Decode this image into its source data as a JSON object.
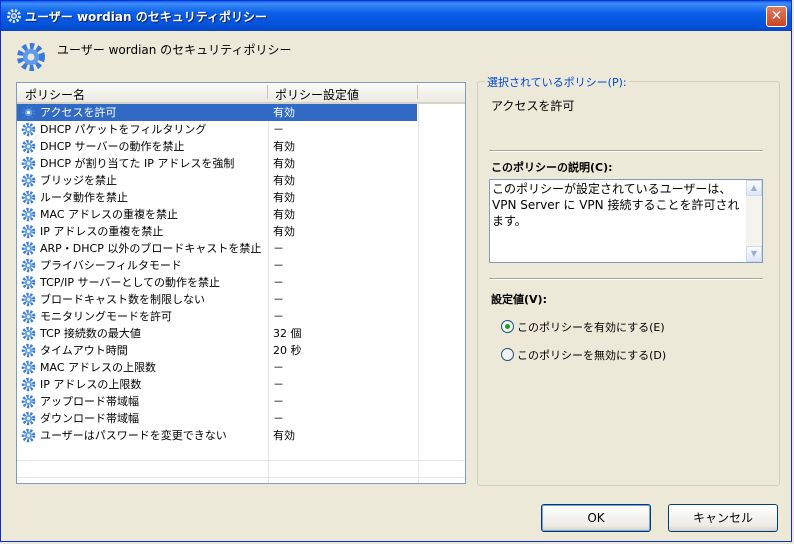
{
  "window": {
    "title": "ユーザー wordian のセキュリティポリシー",
    "close_label": "✕"
  },
  "header": {
    "text": "ユーザー wordian のセキュリティポリシー"
  },
  "list": {
    "columns": [
      "ポリシー名",
      "ポリシー設定値"
    ],
    "rows": [
      {
        "name": "アクセスを許可",
        "value": "有効"
      },
      {
        "name": "DHCP パケットをフィルタリング",
        "value": "－"
      },
      {
        "name": "DHCP サーバーの動作を禁止",
        "value": "有効"
      },
      {
        "name": "DHCP が割り当てた IP アドレスを強制",
        "value": "有効"
      },
      {
        "name": "ブリッジを禁止",
        "value": "有効"
      },
      {
        "name": "ルータ動作を禁止",
        "value": "有効"
      },
      {
        "name": "MAC アドレスの重複を禁止",
        "value": "有効"
      },
      {
        "name": "IP アドレスの重複を禁止",
        "value": "有効"
      },
      {
        "name": "ARP・DHCP 以外のブロードキャストを禁止",
        "value": "－"
      },
      {
        "name": "プライバシーフィルタモード",
        "value": "－"
      },
      {
        "name": "TCP/IP サーバーとしての動作を禁止",
        "value": "－"
      },
      {
        "name": "ブロードキャスト数を制限しない",
        "value": "－"
      },
      {
        "name": "モニタリングモードを許可",
        "value": "－"
      },
      {
        "name": "TCP 接続数の最大値",
        "value": "32 個"
      },
      {
        "name": "タイムアウト時間",
        "value": "20 秒"
      },
      {
        "name": "MAC アドレスの上限数",
        "value": "－"
      },
      {
        "name": "IP アドレスの上限数",
        "value": "－"
      },
      {
        "name": "アップロード帯域幅",
        "value": "－"
      },
      {
        "name": "ダウンロード帯域幅",
        "value": "－"
      },
      {
        "name": "ユーザーはパスワードを変更できない",
        "value": "有効"
      }
    ]
  },
  "detail": {
    "group_label": "選択されているポリシー(P):",
    "policy_name": "アクセスを許可",
    "description_label": "このポリシーの説明(C):",
    "description_text": "このポリシーが設定されているユーザーは、VPN Server に VPN 接続することを許可されます。",
    "setting_label": "設定値(V):",
    "enable_option": "このポリシーを有効にする(E)",
    "disable_option": "このポリシーを無効にする(D)"
  },
  "buttons": {
    "ok": "OK",
    "cancel": "キャンセル"
  },
  "colors": {
    "title_bar": "#0a5fe8",
    "selection": "#316ac5",
    "group_label": "#0046d5"
  }
}
